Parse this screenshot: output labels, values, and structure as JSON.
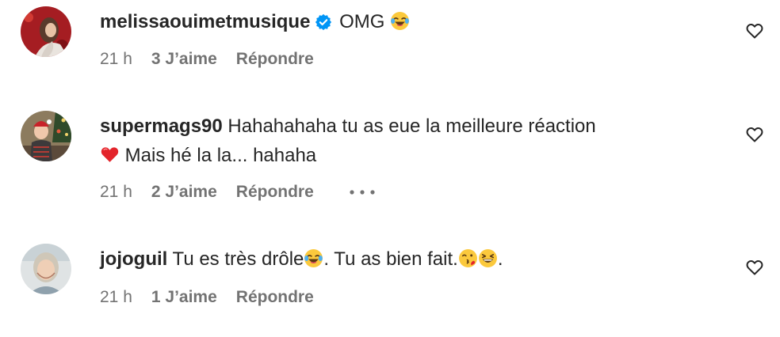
{
  "comments": [
    {
      "username": "melissaouimetmusique",
      "verified": true,
      "text_before": "OMG ",
      "text_emoji_1": "face-with-tears-of-joy",
      "text_after": "",
      "time": "21 h",
      "likes": "3 J’aime",
      "reply": "Répondre",
      "avatar": "woman-red-background-avatar",
      "verified_icon": "verified-badge-icon"
    },
    {
      "username": "supermags90",
      "verified": false,
      "line1": "Hahahahaha tu as eue la meilleure réaction",
      "line2_emoji": "red-heart",
      "line2": " Mais hé la la... hahaha",
      "time": "21 h",
      "likes": "2 J’aime",
      "reply": "Répondre",
      "more": "more-options-icon",
      "avatar": "child-christmas-tree-avatar"
    },
    {
      "username": "jojoguil",
      "verified": false,
      "text_part1": "Tu es très drôle",
      "text_emoji_1": "face-with-tears-of-joy",
      "text_part2": ". Tu as bien fait.",
      "text_emoji_2": "face-blowing-kiss",
      "text_emoji_3": "grinning-squinting-face",
      "text_part3": ".",
      "time": "21 h",
      "likes": "1 J’aime",
      "reply": "Répondre",
      "avatar": "woman-grey-hair-avatar"
    }
  ],
  "colors": {
    "text": "#262626",
    "secondary": "#737373",
    "verified": "#0095f6",
    "heart_outline": "#262626"
  }
}
